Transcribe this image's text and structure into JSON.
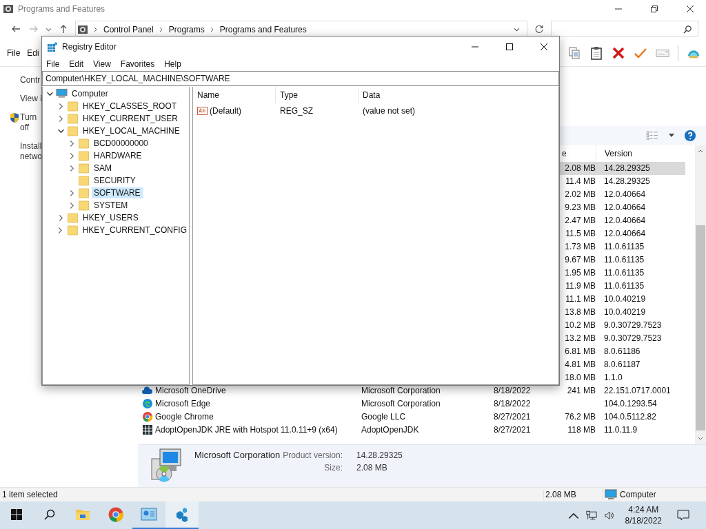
{
  "window": {
    "title": "Programs and Features"
  },
  "address": {
    "crumbs": [
      "Control Panel",
      "Programs",
      "Programs and Features"
    ]
  },
  "menu": [
    "File",
    "Edi"
  ],
  "sidebar": [
    {
      "kind": "link",
      "lines": [
        "Contr"
      ]
    },
    {
      "kind": "link",
      "lines": [
        "View i"
      ]
    },
    {
      "kind": "shield-link",
      "lines": [
        "Turn",
        "off"
      ]
    },
    {
      "kind": "link",
      "lines": [
        "Install",
        "netwo"
      ]
    }
  ],
  "programs": {
    "columns": [
      {
        "label": "e"
      },
      {
        "label": "Version"
      }
    ],
    "rows": [
      {
        "kind": "covered",
        "size": "2.08 MB",
        "version": "14.28.29325",
        "selected": true
      },
      {
        "kind": "covered",
        "size": "11.4 MB",
        "version": "14.28.29325",
        "selected": false
      },
      {
        "kind": "covered",
        "size": "2.02 MB",
        "version": "12.0.40664",
        "selected": false
      },
      {
        "kind": "covered",
        "size": "9.23 MB",
        "version": "12.0.40664",
        "selected": false
      },
      {
        "kind": "covered",
        "size": "2.47 MB",
        "version": "12.0.40664",
        "selected": false
      },
      {
        "kind": "covered",
        "size": "11.5 MB",
        "version": "12.0.40664",
        "selected": false
      },
      {
        "kind": "covered",
        "size": "1.73 MB",
        "version": "11.0.61135",
        "selected": false
      },
      {
        "kind": "covered",
        "size": "9.67 MB",
        "version": "11.0.61135",
        "selected": false
      },
      {
        "kind": "covered",
        "size": "1.95 MB",
        "version": "11.0.61135",
        "selected": false
      },
      {
        "kind": "covered",
        "size": "11.9 MB",
        "version": "11.0.61135",
        "selected": false
      },
      {
        "kind": "covered",
        "size": "11.1 MB",
        "version": "10.0.40219",
        "selected": false
      },
      {
        "kind": "covered",
        "size": "13.8 MB",
        "version": "10.0.40219",
        "selected": false
      },
      {
        "kind": "covered",
        "size": "10.2 MB",
        "version": "9.0.30729.7523",
        "selected": false
      },
      {
        "kind": "covered",
        "size": "13.2 MB",
        "version": "9.0.30729.7523",
        "selected": false
      },
      {
        "kind": "covered",
        "size": "6.81 MB",
        "version": "8.0.61186",
        "selected": false
      },
      {
        "kind": "covered",
        "size": "4.81 MB",
        "version": "8.0.61187",
        "selected": false
      },
      {
        "kind": "covered",
        "size": "18.0 MB",
        "version": "1.1.0",
        "selected": false
      },
      {
        "kind": "cloud",
        "name": "Microsoft OneDrive",
        "publisher": "Microsoft Corporation",
        "installed": "8/18/2022",
        "size": "241 MB",
        "version": "22.151.0717.0001",
        "selected": false
      },
      {
        "kind": "edge",
        "name": "Microsoft Edge",
        "publisher": "Microsoft Corporation",
        "installed": "8/18/2022",
        "version": "104.0.1293.54",
        "selected": false
      },
      {
        "kind": "chrome",
        "name": "Google Chrome",
        "publisher": "Google LLC",
        "installed": "8/27/2021",
        "size": "76.2 MB",
        "version": "104.0.5112.82",
        "selected": false
      },
      {
        "kind": "grid",
        "name": "AdoptOpenJDK JRE with Hotspot 11.0.11+9 (x64)",
        "publisher": "AdoptOpenJDK",
        "installed": "8/27/2021",
        "size": "118 MB",
        "version": "11.0.11.9",
        "selected": false
      }
    ]
  },
  "details": {
    "publisher": "Microsoft Corporation",
    "fields": [
      {
        "label": "Product version:",
        "value": "14.28.29325"
      },
      {
        "label": "Size:",
        "value": "2.08 MB"
      }
    ]
  },
  "status_bar": {
    "selection": "1 item selected",
    "size": "2.08 MB",
    "location": "Computer"
  },
  "registry": {
    "title": "Registry Editor",
    "menu": [
      "File",
      "Edit",
      "View",
      "Favorites",
      "Help"
    ],
    "path": "Computer\\HKEY_LOCAL_MACHINE\\SOFTWARE",
    "tree": [
      {
        "label": "Computer",
        "expandable": true,
        "expanded": true,
        "selected": false,
        "children": [
          {
            "label": "HKEY_CLASSES_ROOT",
            "expandable": true,
            "expanded": false,
            "selected": false
          },
          {
            "label": "HKEY_CURRENT_USER",
            "expandable": true,
            "expanded": false,
            "selected": false
          },
          {
            "label": "HKEY_LOCAL_MACHINE",
            "expandable": true,
            "expanded": true,
            "selected": false,
            "children": [
              {
                "label": "BCD00000000",
                "expandable": true,
                "expanded": false,
                "selected": false
              },
              {
                "label": "HARDWARE",
                "expandable": true,
                "expanded": false,
                "selected": false
              },
              {
                "label": "SAM",
                "expandable": true,
                "expanded": false,
                "selected": false
              },
              {
                "label": "SECURITY",
                "expandable": false,
                "expanded": false,
                "selected": false
              },
              {
                "label": "SOFTWARE",
                "expandable": true,
                "expanded": false,
                "selected": true
              },
              {
                "label": "SYSTEM",
                "expandable": true,
                "expanded": false,
                "selected": false
              }
            ]
          },
          {
            "label": "HKEY_USERS",
            "expandable": true,
            "expanded": false,
            "selected": false
          },
          {
            "label": "HKEY_CURRENT_CONFIG",
            "expandable": true,
            "expanded": false,
            "selected": false
          }
        ]
      }
    ],
    "columns": [
      "Name",
      "Type",
      "Data"
    ],
    "values": [
      {
        "name": "(Default)",
        "type": "REG_SZ",
        "data": "(value not set)"
      }
    ]
  },
  "taskbar": {
    "apps": [
      {
        "kind": "folder",
        "active": false,
        "focused": false
      },
      {
        "kind": "chrome",
        "active": false,
        "focused": false
      },
      {
        "kind": "panel",
        "active": true,
        "focused": false
      },
      {
        "kind": "cubes",
        "active": true,
        "focused": true
      }
    ],
    "time": "4:24 AM",
    "date": "8/18/2022"
  }
}
